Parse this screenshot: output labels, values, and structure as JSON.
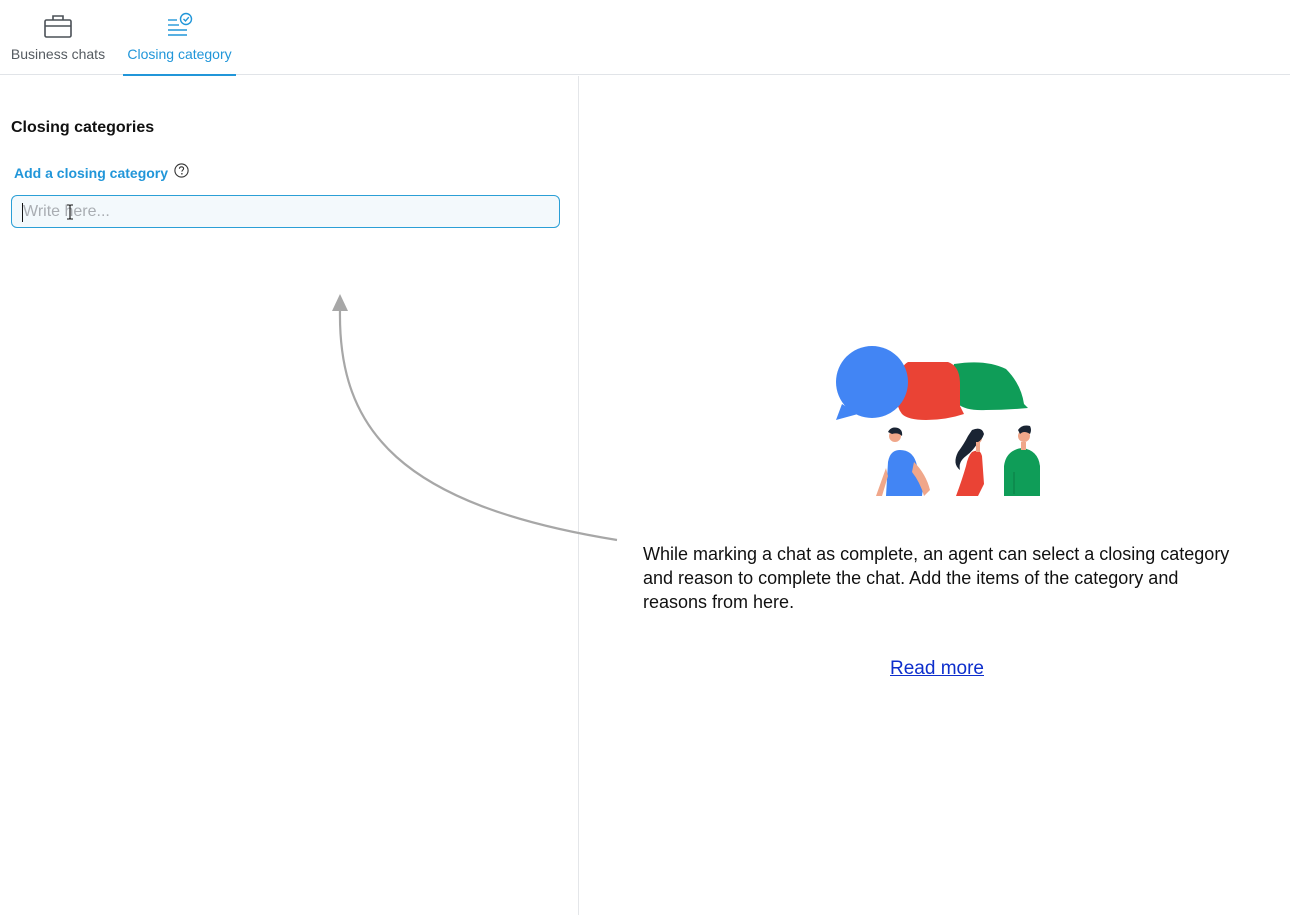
{
  "tabs": {
    "business_chats": {
      "label": "Business chats",
      "icon": "briefcase-icon"
    },
    "closing_category": {
      "label": "Closing category",
      "icon": "list-check-icon",
      "active": true
    }
  },
  "left_panel": {
    "title": "Closing categories",
    "add_field": {
      "label": "Add a closing category",
      "help_icon": "question-circle-icon",
      "placeholder": "Write here...",
      "value": ""
    }
  },
  "right_panel": {
    "illustration": "chat-bubbles-people-illustration",
    "description": "While marking a chat as complete, an agent can select a closing category and reason to complete the chat. Add the items of the category and reasons from here.",
    "read_more": "Read more"
  },
  "colors": {
    "accent": "#2196d9",
    "link": "#0d2ecc",
    "bubble_blue": "#4285f4",
    "bubble_red": "#ea4335",
    "bubble_green": "#0f9d58"
  }
}
